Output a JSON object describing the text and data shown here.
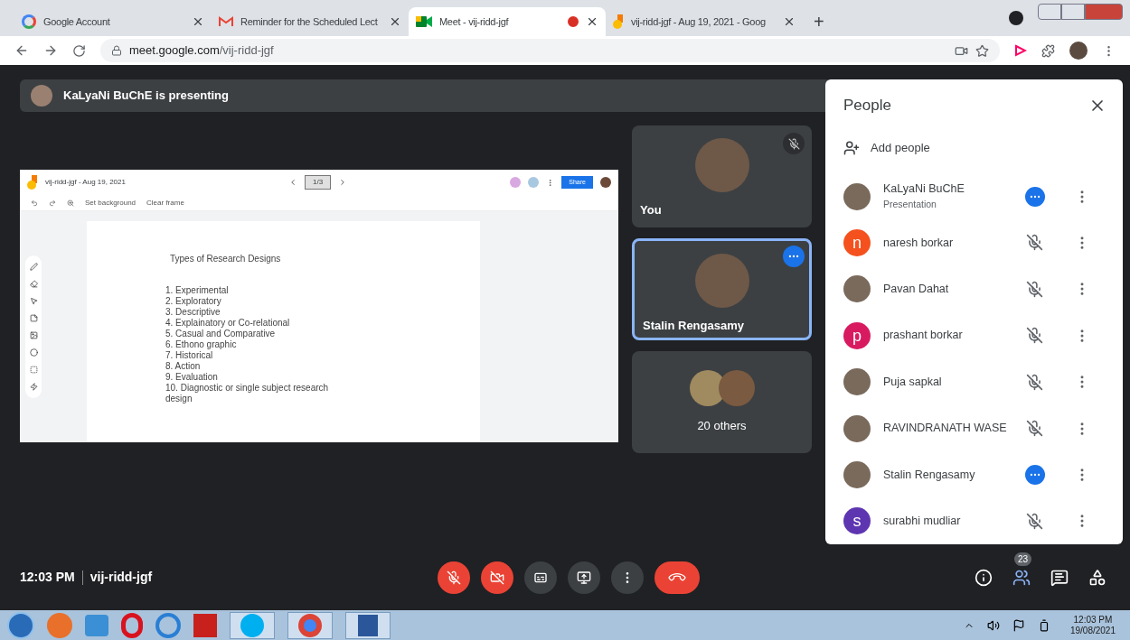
{
  "browser_tabs": [
    {
      "kind": "google",
      "title": "Google Account",
      "selected": false,
      "recording": false
    },
    {
      "kind": "gmail",
      "title": "Reminder for the Scheduled Lect",
      "selected": false,
      "recording": false
    },
    {
      "kind": "meet",
      "title": "Meet - vij-ridd-jgf",
      "selected": true,
      "recording": true
    },
    {
      "kind": "jamboard",
      "title": "vij-ridd-jgf - Aug 19, 2021 - Goog",
      "selected": false,
      "recording": false
    }
  ],
  "new_tab": "+",
  "address": {
    "domain": "meet.google.com",
    "path": "/vij-ridd-jgf"
  },
  "presenter_banner": "KaLyaNi BuChE is presenting",
  "jamboard": {
    "title": "vij-ridd-jgf - Aug 19, 2021",
    "frame_counter": "1/3",
    "share": "Share",
    "toolbar": [
      "Set background",
      "Clear frame"
    ],
    "slide_title": "Types of Research Designs",
    "slide_items": [
      "1. Experimental",
      "2. Exploratory",
      "3. Descriptive",
      "4. Explainatory or Co-relational",
      "5. Casual and Comparative",
      "6. Ethono graphic",
      "7. Historical",
      "8. Action",
      "9. Evaluation",
      "10. Diagnostic or single subject research design"
    ]
  },
  "tiles": [
    {
      "kind": "single",
      "name": "You",
      "muted": true,
      "speaking": false
    },
    {
      "kind": "single",
      "name": "Stalin Rengasamy",
      "muted": false,
      "speaking": true
    },
    {
      "kind": "group",
      "name": "20 others",
      "muted": false,
      "speaking": false
    }
  ],
  "people_panel": {
    "title": "People",
    "add_people": "Add people",
    "people": [
      {
        "name": "KaLyaNi BuChE",
        "subtitle": "Presentation",
        "speaking": true
      },
      {
        "name": "naresh borkar",
        "initial": "n",
        "color": "#f4511e",
        "speaking": false
      },
      {
        "name": "Pavan Dahat",
        "speaking": false
      },
      {
        "name": "prashant borkar",
        "initial": "p",
        "color": "#d81b60",
        "speaking": false
      },
      {
        "name": "Puja sapkal",
        "speaking": false
      },
      {
        "name": "RAVINDRANATH WASE",
        "speaking": false
      },
      {
        "name": "Stalin Rengasamy",
        "speaking": true
      },
      {
        "name": "surabhi mudliar",
        "initial": "s",
        "color": "#5e35b1",
        "speaking": false
      }
    ]
  },
  "bottom_bar": {
    "time": "12:03 PM",
    "meeting_code": "vij-ridd-jgf",
    "mic_on": false,
    "camera_on": false,
    "people_count": "23"
  },
  "taskbar": {
    "time": "12:03 PM",
    "date": "19/08/2021"
  }
}
